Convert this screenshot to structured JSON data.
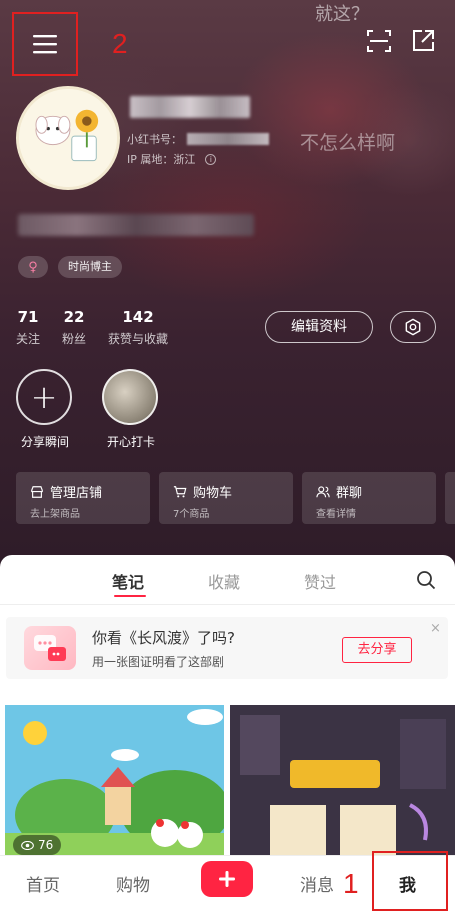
{
  "header": {
    "watermark_top": "就这？",
    "watermark_mid": "不怎么样啊",
    "annotation_menu": "2"
  },
  "profile": {
    "id_label": "小红书号：",
    "ip_label": "IP 属地：浙江",
    "gender_symbol": "♀",
    "role_tag": "时尚博主"
  },
  "stats": [
    {
      "value": "71",
      "label": "关注"
    },
    {
      "value": "22",
      "label": "粉丝"
    },
    {
      "value": "142",
      "label": "获赞与收藏"
    }
  ],
  "actions": {
    "edit_label": "编辑资料"
  },
  "moments": {
    "share_label": "分享瞬间",
    "share_symbol": "+",
    "checkin_label": "开心打卡"
  },
  "cards": [
    {
      "title": "管理店铺",
      "subtitle": "去上架商品",
      "icon": "store-icon"
    },
    {
      "title": "购物车",
      "subtitle": "7个商品",
      "icon": "cart-icon"
    },
    {
      "title": "群聊",
      "subtitle": "查看详情",
      "icon": "group-icon"
    }
  ],
  "content_tabs": [
    {
      "label": "笔记",
      "active": true
    },
    {
      "label": "收藏",
      "active": false
    },
    {
      "label": "赞过",
      "active": false
    }
  ],
  "promo": {
    "title": "你看《长风渡》了吗?",
    "subtitle": "用一张图证明看了这部剧",
    "button": "去分享",
    "close": "×"
  },
  "tiles": [
    {
      "views": "76"
    }
  ],
  "nav": {
    "home": "首页",
    "shop": "购物",
    "messages": "消息",
    "me": "我",
    "annotation_me": "1"
  },
  "colors": {
    "accent": "#ff2442",
    "annotation": "#e02020"
  }
}
